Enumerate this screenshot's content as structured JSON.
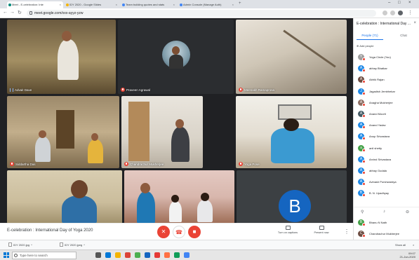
{
  "browser": {
    "tabs": [
      {
        "label": "Meet - E-celebration: Inte",
        "active": true,
        "color": "#00897b"
      },
      {
        "label": "IDY 2020 - Google Slides",
        "active": false,
        "color": "#f4b400"
      },
      {
        "label": "Team building quotes and stats",
        "active": false,
        "color": "#4285f4"
      },
      {
        "label": "Admin Console (Manage Auth)",
        "active": false,
        "color": "#4285f4"
      }
    ],
    "url": "meet.google.com/xxx-ayyz-yzw"
  },
  "meeting": {
    "title": "E-celebration : International Day of Yoga 2020",
    "rec_label": "REC",
    "tiles": [
      {
        "name": "Advait Dave"
      },
      {
        "name": "Praveen Agrawal"
      },
      {
        "name": "Meenakh Ramaprosa"
      },
      {
        "name": "Siddartha Das"
      },
      {
        "name": "Chandrachur Mukherjee"
      },
      {
        "name": "Yoga Pose"
      },
      {
        "name": ""
      },
      {
        "name": ""
      },
      {
        "name": "",
        "avatar": "B"
      }
    ],
    "controls": {
      "captions": "Turn on captions",
      "present": "Present now"
    }
  },
  "panel": {
    "title": "E-celebration : International Day ...",
    "tab_people": "People (71)",
    "tab_chat": "Chat",
    "add_people": "Add people",
    "participants": [
      {
        "name": "Yoga Circle (You)",
        "initial": "Y",
        "color": "#9e9e9e"
      },
      {
        "name": "abhay Bhatkar",
        "initial": "A",
        "color": "#1e88e5"
      },
      {
        "name": "Abhik Rajan",
        "initial": "A",
        "color": "#6d4c41"
      },
      {
        "name": "Jagadish Jembhekar",
        "initial": "J",
        "color": "#1e88e5"
      },
      {
        "name": "Anagha Mukherjee",
        "initial": "A",
        "color": "#8d6e63"
      },
      {
        "name": "Anand Moorti",
        "initial": "A",
        "color": "#455a64"
      },
      {
        "name": "Anand Yadav",
        "initial": "A",
        "color": "#1e88e5"
      },
      {
        "name": "Anup Srivastava",
        "initial": "A",
        "color": "#1e88e5"
      },
      {
        "name": "anil shetty",
        "initial": "a",
        "color": "#43a047"
      },
      {
        "name": "Arvind Srivastava",
        "initial": "A",
        "color": "#1e88e5"
      },
      {
        "name": "abhay Gudala",
        "initial": "A",
        "color": "#1e88e5"
      },
      {
        "name": "Avinash Purshwardya",
        "initial": "A",
        "color": "#1e88e5"
      },
      {
        "name": "B. N. Upadhyay",
        "initial": "B",
        "color": "#1e88e5"
      }
    ],
    "participants_below": [
      {
        "name": "Bhanu N Nath",
        "initial": "B",
        "color": "#43a047"
      },
      {
        "name": "Chandrachur Mukherjee",
        "initial": "C",
        "color": "#6d4c41"
      }
    ]
  },
  "downloads": {
    "items": [
      "IDY 2020.jpg",
      "IDY 2020.jpeg"
    ],
    "show_all": "Show all"
  },
  "taskbar": {
    "search_placeholder": "Type here to search",
    "time": "09:07",
    "date": "21-Jun-2020"
  }
}
